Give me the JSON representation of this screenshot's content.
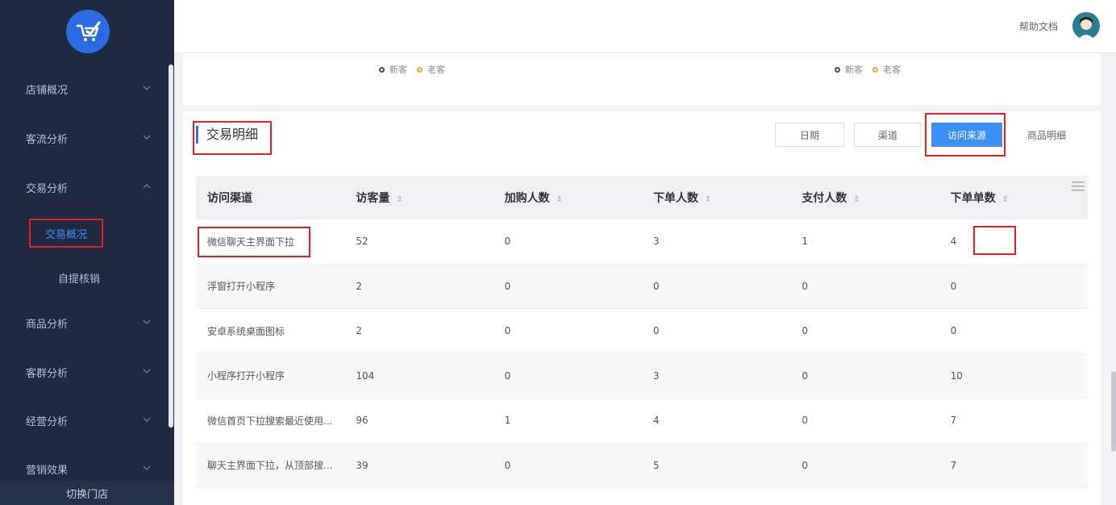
{
  "header": {
    "help_doc": "帮助文档"
  },
  "sidebar": {
    "items": [
      {
        "label": "店铺概况"
      },
      {
        "label": "客流分析"
      },
      {
        "label": "交易分析"
      },
      {
        "label": "商品分析"
      },
      {
        "label": "客群分析"
      },
      {
        "label": "经营分析"
      },
      {
        "label": "营销效果"
      }
    ],
    "sub_items": [
      {
        "label": "交易概况",
        "active": true
      },
      {
        "label": "自提核销",
        "active": false
      }
    ],
    "switch_store": "切换门店"
  },
  "legends": [
    {
      "items": [
        {
          "label": "新客",
          "color": "#3d4a7a"
        },
        {
          "label": "老客",
          "color": "#f5a623"
        }
      ]
    },
    {
      "items": [
        {
          "label": "新客",
          "color": "#3d4a7a"
        },
        {
          "label": "老客",
          "color": "#f5a623"
        }
      ]
    }
  ],
  "section": {
    "title": "交易明细",
    "tabs": [
      {
        "label": "日期",
        "active": false
      },
      {
        "label": "渠道",
        "active": false
      },
      {
        "label": "访问来源",
        "active": true
      },
      {
        "label": "商品明细",
        "active": false
      }
    ]
  },
  "table": {
    "columns": [
      "访问渠道",
      "访客量",
      "加购人数",
      "下单人数",
      "支付人数",
      "下单单数"
    ],
    "rows": [
      [
        "微信聊天主界面下拉",
        "52",
        "0",
        "3",
        "1",
        "4"
      ],
      [
        "浮窗打开小程序",
        "2",
        "0",
        "0",
        "0",
        "0"
      ],
      [
        "安卓系统桌面图标",
        "2",
        "0",
        "0",
        "0",
        "0"
      ],
      [
        "小程序打开小程序",
        "104",
        "0",
        "3",
        "0",
        "10"
      ],
      [
        "微信首页下拉搜索最近使用...",
        "96",
        "1",
        "4",
        "0",
        "7"
      ],
      [
        "聊天主界面下拉，从顶部搜...",
        "39",
        "0",
        "5",
        "0",
        "7"
      ]
    ]
  },
  "colors": {
    "sidebar_bg": "#1f2942",
    "accent": "#3b8ff5",
    "highlight": "#e02020"
  }
}
